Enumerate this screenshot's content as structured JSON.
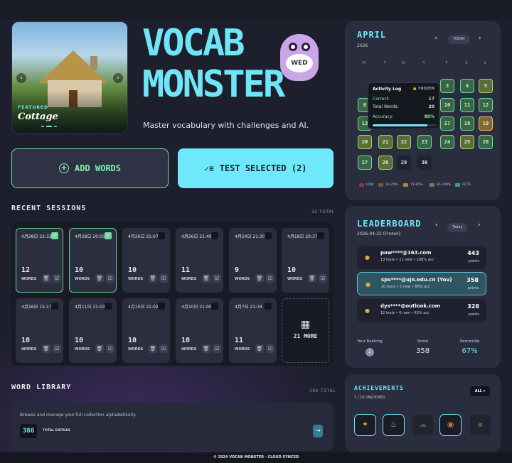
{
  "hero": {
    "featured_tag": "FEATURED",
    "featured_title": "Cottage",
    "title_line1": "VOCAB",
    "title_line2": "MONSTER",
    "tagline": "Master vocabulary with challenges and AI.",
    "mascot_sign": "WED"
  },
  "actions": {
    "add_words": "ADD WORDS",
    "test_selected": "TEST SELECTED (2)"
  },
  "recent_sessions": {
    "heading": "RECENT SESSIONS",
    "total": "32 TOTAL",
    "words_label": "WORDS",
    "more_label": "21 MORE",
    "items": [
      {
        "date": "4月28日 22:32",
        "count": "12",
        "selected": true
      },
      {
        "date": "4月28日 20:05",
        "count": "10",
        "selected": true
      },
      {
        "date": "4月26日 21:07",
        "count": "10",
        "selected": false
      },
      {
        "date": "4月26日 21:49",
        "count": "11",
        "selected": false
      },
      {
        "date": "4月24日 21:30",
        "count": "9",
        "selected": false
      },
      {
        "date": "4月18日 20:37",
        "count": "10",
        "selected": false
      },
      {
        "date": "4月16日 15:17",
        "count": "10",
        "selected": false
      },
      {
        "date": "4月11日 21:03",
        "count": "10",
        "selected": false
      },
      {
        "date": "4月10日 21:02",
        "count": "10",
        "selected": false
      },
      {
        "date": "4月10日 21:00",
        "count": "10",
        "selected": false
      },
      {
        "date": "4月7日 21:34",
        "count": "11",
        "selected": false
      }
    ]
  },
  "word_library": {
    "heading": "WORD LIBRARY",
    "total": "386 TOTAL",
    "description": "Browse and manage your full collection alphabetically.",
    "count": "386",
    "count_label": "TOTAL ENTRIES"
  },
  "calendar": {
    "month": "APRIL",
    "year": "2026",
    "prev": "‹",
    "next": "›",
    "today": "TODAY",
    "weekdays": [
      "M",
      "T",
      "W",
      "T",
      "F",
      "S",
      "S"
    ],
    "days": [
      {
        "day": "3",
        "level": "g1"
      },
      {
        "day": "4",
        "level": "g1"
      },
      {
        "day": "5",
        "level": "g2"
      },
      {
        "day": "6",
        "level": "g1"
      },
      {
        "day": "10",
        "level": "g1"
      },
      {
        "day": "11",
        "level": "g1"
      },
      {
        "day": "12",
        "level": "g1"
      },
      {
        "day": "13",
        "level": "g1"
      },
      {
        "day": "17",
        "level": "g1"
      },
      {
        "day": "18",
        "level": "g1"
      },
      {
        "day": "19",
        "level": "g3"
      },
      {
        "day": "20",
        "level": "g2"
      },
      {
        "day": "21",
        "level": "g2"
      },
      {
        "day": "22",
        "level": "g2"
      },
      {
        "day": "23",
        "level": "g1"
      },
      {
        "day": "24",
        "level": "g1"
      },
      {
        "day": "25",
        "level": "g2"
      },
      {
        "day": "26",
        "level": "g1"
      },
      {
        "day": "27",
        "level": "g1"
      },
      {
        "day": "28",
        "level": "g2"
      },
      {
        "day": "29",
        "level": "gd"
      },
      {
        "day": "30",
        "level": "gd"
      }
    ],
    "tooltip": {
      "title": "Activity Log",
      "status": "FROZEN",
      "correct_label": "Correct:",
      "correct_value": "17",
      "total_label": "Total Words:",
      "total_value": "20",
      "accuracy_label": "Accuracy:",
      "accuracy_value": "85%",
      "accuracy_fraction": 0.85
    },
    "legend": [
      "LOW",
      "50-70%",
      "71-85%",
      "81-100%",
      "ELITE"
    ],
    "legend_colors": [
      "#8a3a3a",
      "#7a5a34",
      "#a58a3a",
      "#5a8a4a",
      "#3fa07a"
    ]
  },
  "leaderboard": {
    "title": "LEADERBOARD",
    "date": "2026-04-22 (Frozen)",
    "period": "Today",
    "prev": "‹",
    "next": "›",
    "points_label": "points",
    "rows": [
      {
        "email": "pow****@163.com",
        "meta": "13 tests • 11 new • 108% acc",
        "points": "443"
      },
      {
        "email": "sps****@ujn.edu.cn (You)",
        "meta": "20 tests • 1 new • 86% acc",
        "points": "358"
      },
      {
        "email": "dys****@outlook.com",
        "meta": "12 tests • 0 new • 63% acc",
        "points": "328"
      }
    ],
    "ranking_label": "Your Ranking",
    "ranking_value": "2",
    "score_label": "Score",
    "score_value": "358",
    "percentile_label": "Percentile",
    "percentile_value": "67%"
  },
  "achievements": {
    "title": "ACHIEVEMENTS",
    "unlocked": "7 / 10 UNLOCKED",
    "filter": "ALL",
    "icons": [
      "compass-icon",
      "flame-icon",
      "cloud-icon",
      "owl-icon",
      "lock-icon"
    ]
  },
  "footer": "© 2024 VOCAB MONSTER - CLOUD SYNCED"
}
